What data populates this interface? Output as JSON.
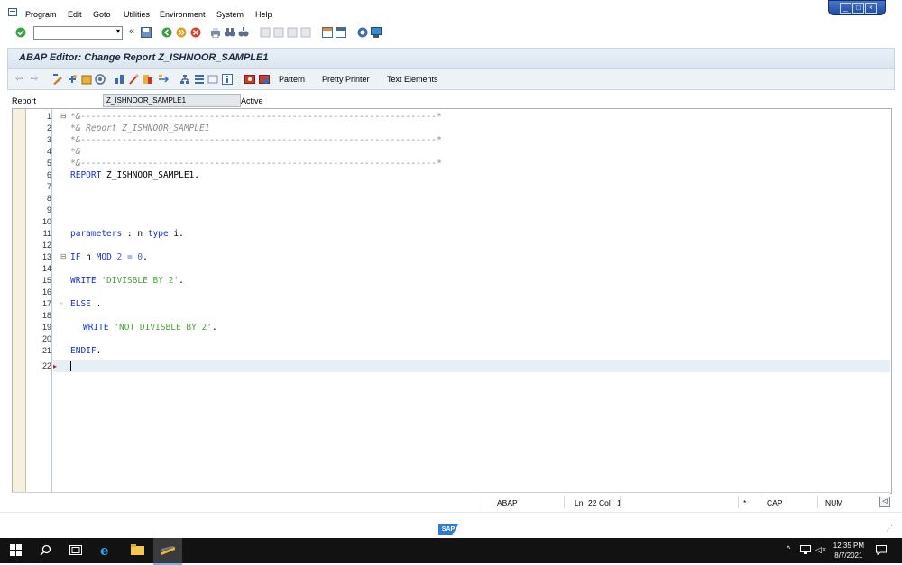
{
  "menu": {
    "items": [
      "Program",
      "Edit",
      "Goto",
      "Utilities",
      "Environment",
      "System",
      "Help"
    ]
  },
  "toolbar": {
    "command_field_value": ""
  },
  "title": "ABAP Editor: Change Report Z_ISHNOOR_SAMPLE1",
  "app_toolbar": {
    "pattern": "Pattern",
    "pretty_printer": "Pretty Printer",
    "text_elements": "Text Elements"
  },
  "report_row": {
    "label": "Report",
    "value": "Z_ISHNOOR_SAMPLE1",
    "status": "Active"
  },
  "editor": {
    "line_numbers": [
      "1",
      "2",
      "3",
      "4",
      "5",
      "6",
      "7",
      "8",
      "9",
      "10",
      "11",
      "12",
      "13",
      "14",
      "15",
      "16",
      "17",
      "18",
      "19",
      "20",
      "21",
      "22"
    ],
    "lines": {
      "l1": "*&---------------------------------------------------------------------*",
      "l2": "*& Report Z_ISHNOOR_SAMPLE1",
      "l3": "*&---------------------------------------------------------------------*",
      "l4": "*&",
      "l5": "*&---------------------------------------------------------------------*",
      "l6_kw": "REPORT",
      "l6_rest": " Z_ISHNOOR_SAMPLE1.",
      "l11_kw": "parameters",
      "l11_mid": " : n ",
      "l11_kw2": "type",
      "l11_rest": " i.",
      "l13_kw": "IF",
      "l13_a": " n ",
      "l13_kw2": "MOD",
      "l13_num": " 2 = 0",
      "l13_end": ".",
      "l15_kw": "WRITE",
      "l15_str": " 'DIVISBLE BY 2'",
      "l15_end": ".",
      "l17_kw": "ELSE",
      "l17_rest": " .",
      "l19_kw": "WRITE",
      "l19_str": " 'NOT DIVISBLE BY 2'",
      "l19_end": ".",
      "l21_kw": "ENDIF",
      "l21_end": "."
    }
  },
  "status": {
    "lang": "ABAP",
    "ln_label": "Ln",
    "ln": "22",
    "col_label": "Col",
    "col": "1",
    "star": "*",
    "cap": "CAP",
    "num": "NUM"
  },
  "footer": {
    "logo": "SAP"
  },
  "taskbar": {
    "time": "12:35 PM",
    "date": "8/7/2021"
  }
}
